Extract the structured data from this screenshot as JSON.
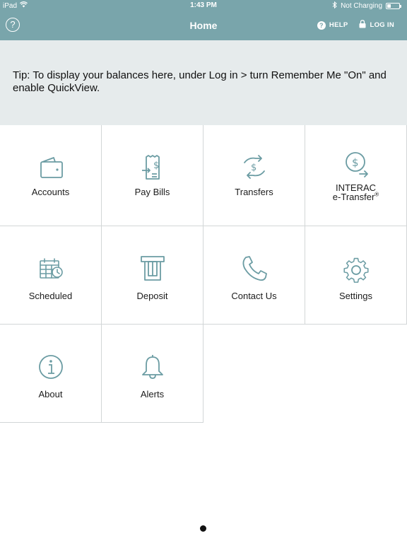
{
  "status_bar": {
    "device": "iPad",
    "time": "1:43 PM",
    "battery_status": "Not Charging",
    "battery_level": 0.3
  },
  "nav": {
    "help_glyph": "?",
    "title": "Home",
    "help_label": "HELP",
    "login_label": "LOG IN"
  },
  "tip": {
    "text": "Tip: To display your balances here, under Log in > turn Remember Me \"On\" and enable QuickView."
  },
  "tiles": {
    "accounts": "Accounts",
    "pay_bills": "Pay Bills",
    "transfers": "Transfers",
    "interac_line1": "INTERAC",
    "interac_line2": "e-Transfer",
    "interac_mark": "®",
    "scheduled": "Scheduled",
    "deposit": "Deposit",
    "contact_us": "Contact Us",
    "settings": "Settings",
    "about": "About",
    "alerts": "Alerts"
  },
  "colors": {
    "header": "#79a5ab",
    "icon": "#6b9ca3",
    "tip_background": "#e6ebec"
  }
}
